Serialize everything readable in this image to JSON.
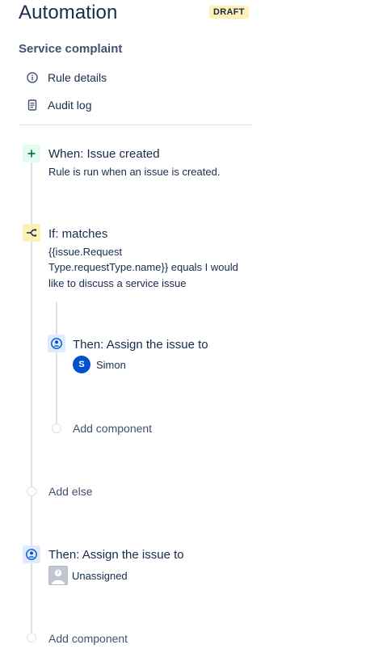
{
  "header": {
    "title": "Automation",
    "status_badge": "DRAFT"
  },
  "rule": {
    "name": "Service complaint"
  },
  "nav": {
    "items": [
      {
        "label": "Rule details",
        "icon": "info-icon"
      },
      {
        "label": "Audit log",
        "icon": "document-icon"
      }
    ]
  },
  "colors": {
    "text": "#172b4d",
    "subtle": "#42526e",
    "line": "#dfe1e6",
    "trigger_bg": "#e3fcef",
    "trigger_fg": "#006644",
    "condition_bg": "#fff0b3",
    "condition_fg": "#172b4d",
    "action_bg": "#deebff",
    "action_fg": "#0052cc",
    "badge_bg": "#fff0b3",
    "avatar_blue": "#0052cc"
  },
  "steps": {
    "trigger": {
      "title": "When: Issue created",
      "description": "Rule is run when an issue is created.",
      "icon": "plus-icon"
    },
    "condition": {
      "title": "If: matches",
      "description_lines": [
        "{{issue.Request",
        "Type.requestType.name}} equals I would",
        "like to discuss a service issue"
      ],
      "icon": "branch-icon"
    },
    "inner_action": {
      "title": "Then: Assign the issue to",
      "assignee": "Simon",
      "assignee_initial": "S",
      "icon": "person-icon"
    },
    "inner_add": {
      "label": "Add component"
    },
    "add_else": {
      "label": "Add else"
    },
    "outer_action": {
      "title": "Then: Assign the issue to",
      "assignee": "Unassigned",
      "icon": "person-icon"
    },
    "outer_add": {
      "label": "Add component"
    }
  }
}
